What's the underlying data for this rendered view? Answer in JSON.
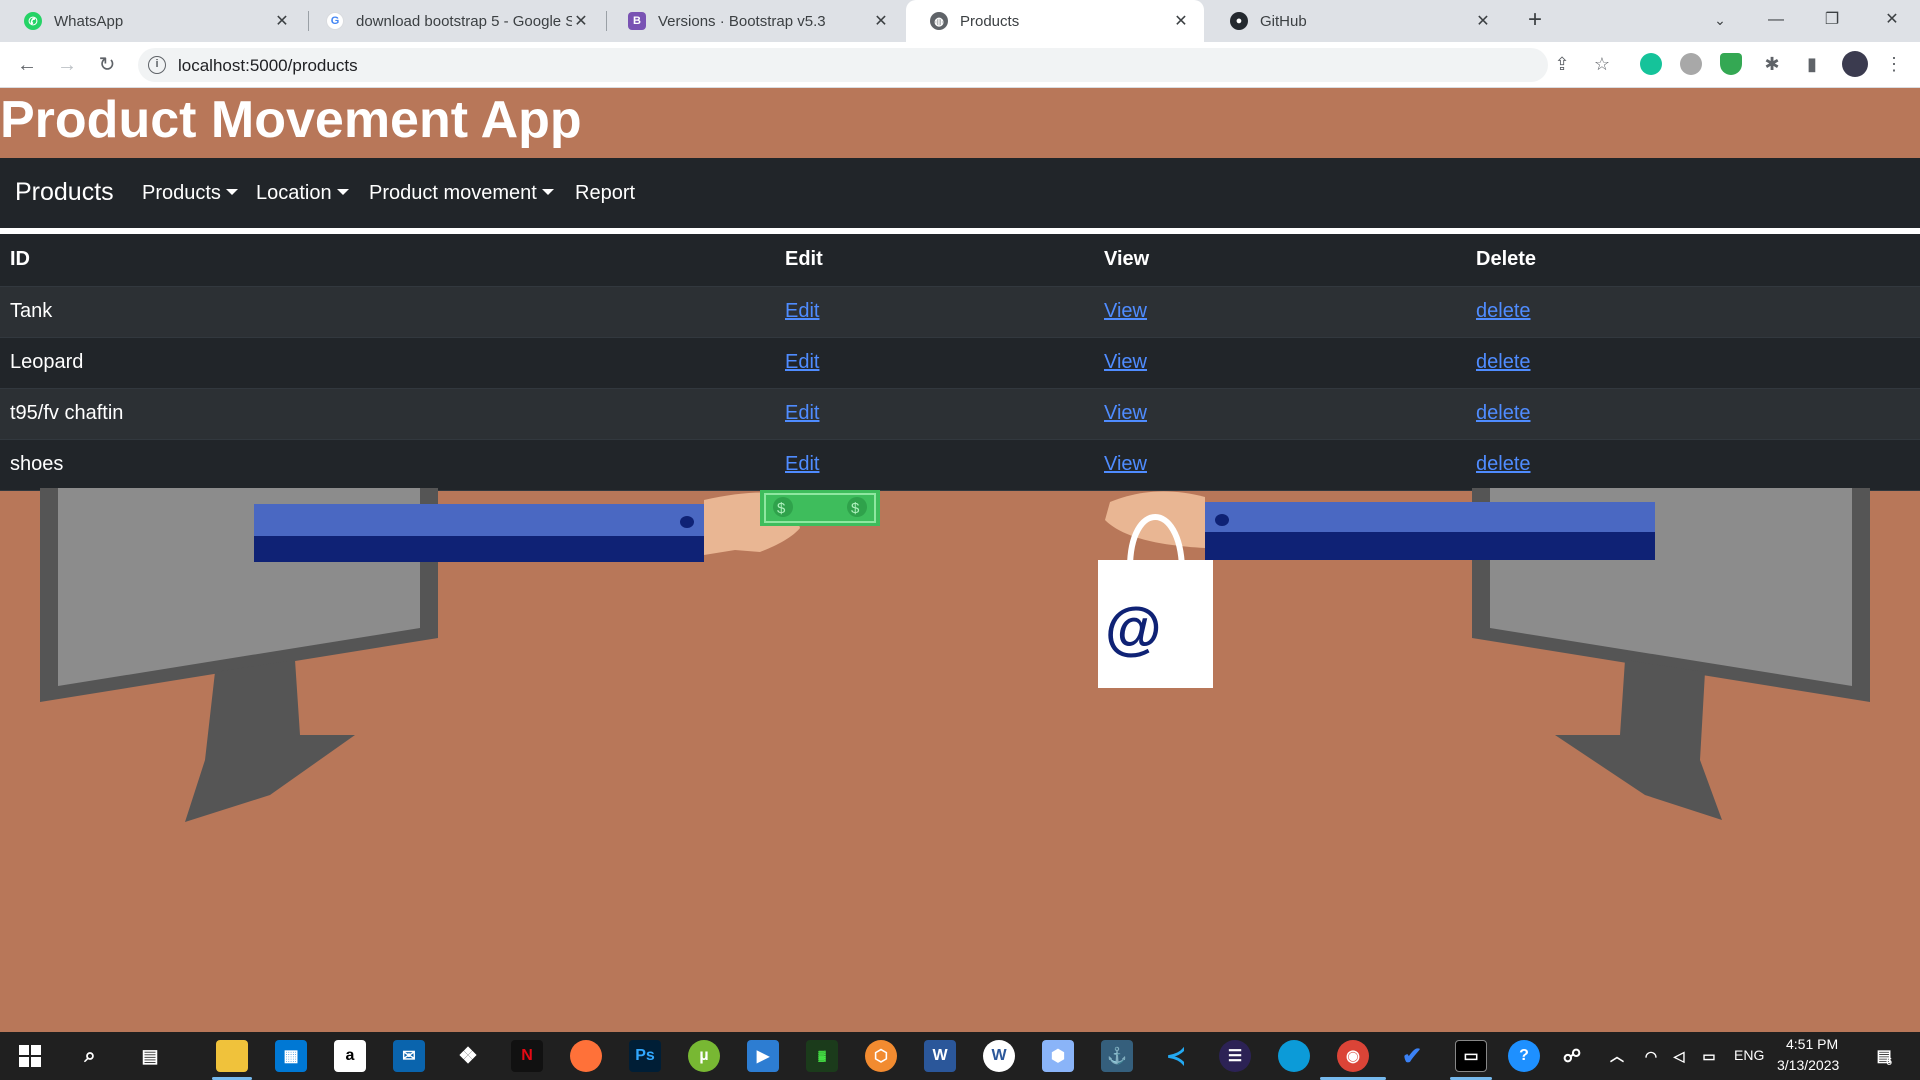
{
  "browser": {
    "tabs": [
      {
        "title": "WhatsApp",
        "icon": "whatsapp-icon",
        "color": "#25d366"
      },
      {
        "title": "download bootstrap 5 - Google S",
        "icon": "google-icon",
        "color": "#4285f4"
      },
      {
        "title": "Versions · Bootstrap v5.3",
        "icon": "bootstrap-icon",
        "color": "#7952b3"
      },
      {
        "title": "Products",
        "icon": "globe-icon",
        "color": "#5f6368"
      },
      {
        "title": "GitHub",
        "icon": "github-icon",
        "color": "#24292f"
      }
    ],
    "active_tab": 3,
    "url": "localhost:5000/products"
  },
  "page": {
    "title": "Product Movement App",
    "navbar": {
      "brand": "Products",
      "items": [
        {
          "label": "Products",
          "dropdown": true
        },
        {
          "label": "Location",
          "dropdown": true
        },
        {
          "label": "Product movement",
          "dropdown": true
        },
        {
          "label": "Report",
          "dropdown": false
        }
      ]
    },
    "table": {
      "headers": [
        "ID",
        "Edit",
        "View",
        "Delete"
      ],
      "rows": [
        {
          "id": "Tank",
          "edit": "Edit",
          "view": "View",
          "delete": "delete"
        },
        {
          "id": "Leopard",
          "edit": "Edit",
          "view": "View",
          "delete": "delete"
        },
        {
          "id": "t95/fv chaftin",
          "edit": "Edit",
          "view": "View",
          "delete": "delete"
        },
        {
          "id": "shoes",
          "edit": "Edit",
          "view": "View",
          "delete": "delete"
        }
      ]
    },
    "background_color": "#b87759",
    "navbar_color": "#212529",
    "link_color": "#4f8cff"
  },
  "taskbar": {
    "language": "ENG",
    "time": "4:51 PM",
    "date": "3/13/2023",
    "notification_count": "6",
    "pinned_apps": [
      "start-icon",
      "search-icon",
      "task-view-icon",
      "file-explorer-icon",
      "store-icon",
      "amazon-icon",
      "mail-icon",
      "dropbox-icon",
      "netflix-icon",
      "firefox-icon",
      "photoshop-icon",
      "utorrent-icon",
      "video-editor-icon",
      "terminal-icon",
      "app-icon",
      "word-icon",
      "app-icon",
      "box-icon",
      "mysql-workbench-icon",
      "vscode-icon",
      "eclipse-icon",
      "edge-icon",
      "chrome-icon",
      "todo-icon",
      "cmd-icon",
      "help-icon"
    ]
  }
}
